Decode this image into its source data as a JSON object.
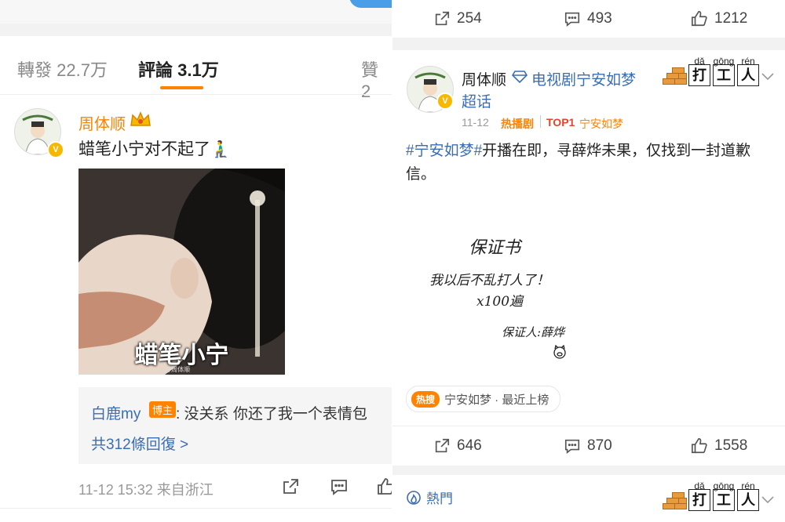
{
  "left": {
    "tabs": [
      {
        "label": "轉發 22.7万"
      },
      {
        "label": "評論 3.1万"
      },
      {
        "label": "贊 2"
      }
    ],
    "comment": {
      "author": "周体顺",
      "text": "蜡笔小宁对不起了🧎‍♂️",
      "image_caption": "蜡笔小宁",
      "image_watermark": "@周体顺",
      "reply": {
        "author": "白鹿my",
        "badge": "博主",
        "text": ": 没关系 你还了我一个表情包"
      },
      "reply_count": "共312條回復 >",
      "meta": "11-12 15:32 来自浙江"
    }
  },
  "right": {
    "top_actions": {
      "share": "254",
      "comment": "493",
      "like": "1212"
    },
    "post": {
      "author": "周体顺",
      "topic": "电视剧宁安如梦",
      "topic_suffix": "超话",
      "date": "11-12",
      "tag_hot": "热播剧",
      "tag_top": "TOP1",
      "tag_show": "宁安如梦",
      "hashtag": "#宁安如梦#",
      "text": "开播在即，寻薛烨未果，仅找到一封道歉信。",
      "letter": {
        "title": "保证书",
        "line1": "我以后不乱打人了！",
        "line2": "x100遍",
        "signer": "保证人:薛烨"
      },
      "hot_search": {
        "badge": "热搜",
        "text": "宁安如梦 · 最近上榜"
      },
      "actions": {
        "share": "646",
        "comment": "870",
        "like": "1558"
      }
    },
    "badge_pinyin": [
      {
        "py": "dǎ",
        "char": "打"
      },
      {
        "py": "gōng",
        "char": "工"
      },
      {
        "py": "rén",
        "char": "人"
      }
    ],
    "bottom_label": "熱門"
  }
}
